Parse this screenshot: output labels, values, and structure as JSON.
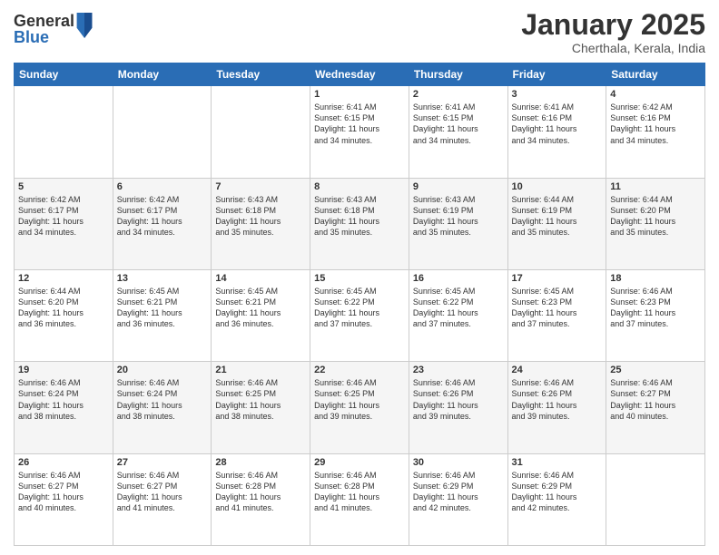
{
  "logo": {
    "general": "General",
    "blue": "Blue"
  },
  "header": {
    "month": "January 2025",
    "location": "Cherthala, Kerala, India"
  },
  "weekdays": [
    "Sunday",
    "Monday",
    "Tuesday",
    "Wednesday",
    "Thursday",
    "Friday",
    "Saturday"
  ],
  "weeks": [
    [
      {
        "day": "",
        "info": ""
      },
      {
        "day": "",
        "info": ""
      },
      {
        "day": "",
        "info": ""
      },
      {
        "day": "1",
        "info": "Sunrise: 6:41 AM\nSunset: 6:15 PM\nDaylight: 11 hours\nand 34 minutes."
      },
      {
        "day": "2",
        "info": "Sunrise: 6:41 AM\nSunset: 6:15 PM\nDaylight: 11 hours\nand 34 minutes."
      },
      {
        "day": "3",
        "info": "Sunrise: 6:41 AM\nSunset: 6:16 PM\nDaylight: 11 hours\nand 34 minutes."
      },
      {
        "day": "4",
        "info": "Sunrise: 6:42 AM\nSunset: 6:16 PM\nDaylight: 11 hours\nand 34 minutes."
      }
    ],
    [
      {
        "day": "5",
        "info": "Sunrise: 6:42 AM\nSunset: 6:17 PM\nDaylight: 11 hours\nand 34 minutes."
      },
      {
        "day": "6",
        "info": "Sunrise: 6:42 AM\nSunset: 6:17 PM\nDaylight: 11 hours\nand 34 minutes."
      },
      {
        "day": "7",
        "info": "Sunrise: 6:43 AM\nSunset: 6:18 PM\nDaylight: 11 hours\nand 35 minutes."
      },
      {
        "day": "8",
        "info": "Sunrise: 6:43 AM\nSunset: 6:18 PM\nDaylight: 11 hours\nand 35 minutes."
      },
      {
        "day": "9",
        "info": "Sunrise: 6:43 AM\nSunset: 6:19 PM\nDaylight: 11 hours\nand 35 minutes."
      },
      {
        "day": "10",
        "info": "Sunrise: 6:44 AM\nSunset: 6:19 PM\nDaylight: 11 hours\nand 35 minutes."
      },
      {
        "day": "11",
        "info": "Sunrise: 6:44 AM\nSunset: 6:20 PM\nDaylight: 11 hours\nand 35 minutes."
      }
    ],
    [
      {
        "day": "12",
        "info": "Sunrise: 6:44 AM\nSunset: 6:20 PM\nDaylight: 11 hours\nand 36 minutes."
      },
      {
        "day": "13",
        "info": "Sunrise: 6:45 AM\nSunset: 6:21 PM\nDaylight: 11 hours\nand 36 minutes."
      },
      {
        "day": "14",
        "info": "Sunrise: 6:45 AM\nSunset: 6:21 PM\nDaylight: 11 hours\nand 36 minutes."
      },
      {
        "day": "15",
        "info": "Sunrise: 6:45 AM\nSunset: 6:22 PM\nDaylight: 11 hours\nand 37 minutes."
      },
      {
        "day": "16",
        "info": "Sunrise: 6:45 AM\nSunset: 6:22 PM\nDaylight: 11 hours\nand 37 minutes."
      },
      {
        "day": "17",
        "info": "Sunrise: 6:45 AM\nSunset: 6:23 PM\nDaylight: 11 hours\nand 37 minutes."
      },
      {
        "day": "18",
        "info": "Sunrise: 6:46 AM\nSunset: 6:23 PM\nDaylight: 11 hours\nand 37 minutes."
      }
    ],
    [
      {
        "day": "19",
        "info": "Sunrise: 6:46 AM\nSunset: 6:24 PM\nDaylight: 11 hours\nand 38 minutes."
      },
      {
        "day": "20",
        "info": "Sunrise: 6:46 AM\nSunset: 6:24 PM\nDaylight: 11 hours\nand 38 minutes."
      },
      {
        "day": "21",
        "info": "Sunrise: 6:46 AM\nSunset: 6:25 PM\nDaylight: 11 hours\nand 38 minutes."
      },
      {
        "day": "22",
        "info": "Sunrise: 6:46 AM\nSunset: 6:25 PM\nDaylight: 11 hours\nand 39 minutes."
      },
      {
        "day": "23",
        "info": "Sunrise: 6:46 AM\nSunset: 6:26 PM\nDaylight: 11 hours\nand 39 minutes."
      },
      {
        "day": "24",
        "info": "Sunrise: 6:46 AM\nSunset: 6:26 PM\nDaylight: 11 hours\nand 39 minutes."
      },
      {
        "day": "25",
        "info": "Sunrise: 6:46 AM\nSunset: 6:27 PM\nDaylight: 11 hours\nand 40 minutes."
      }
    ],
    [
      {
        "day": "26",
        "info": "Sunrise: 6:46 AM\nSunset: 6:27 PM\nDaylight: 11 hours\nand 40 minutes."
      },
      {
        "day": "27",
        "info": "Sunrise: 6:46 AM\nSunset: 6:27 PM\nDaylight: 11 hours\nand 41 minutes."
      },
      {
        "day": "28",
        "info": "Sunrise: 6:46 AM\nSunset: 6:28 PM\nDaylight: 11 hours\nand 41 minutes."
      },
      {
        "day": "29",
        "info": "Sunrise: 6:46 AM\nSunset: 6:28 PM\nDaylight: 11 hours\nand 41 minutes."
      },
      {
        "day": "30",
        "info": "Sunrise: 6:46 AM\nSunset: 6:29 PM\nDaylight: 11 hours\nand 42 minutes."
      },
      {
        "day": "31",
        "info": "Sunrise: 6:46 AM\nSunset: 6:29 PM\nDaylight: 11 hours\nand 42 minutes."
      },
      {
        "day": "",
        "info": ""
      }
    ]
  ]
}
